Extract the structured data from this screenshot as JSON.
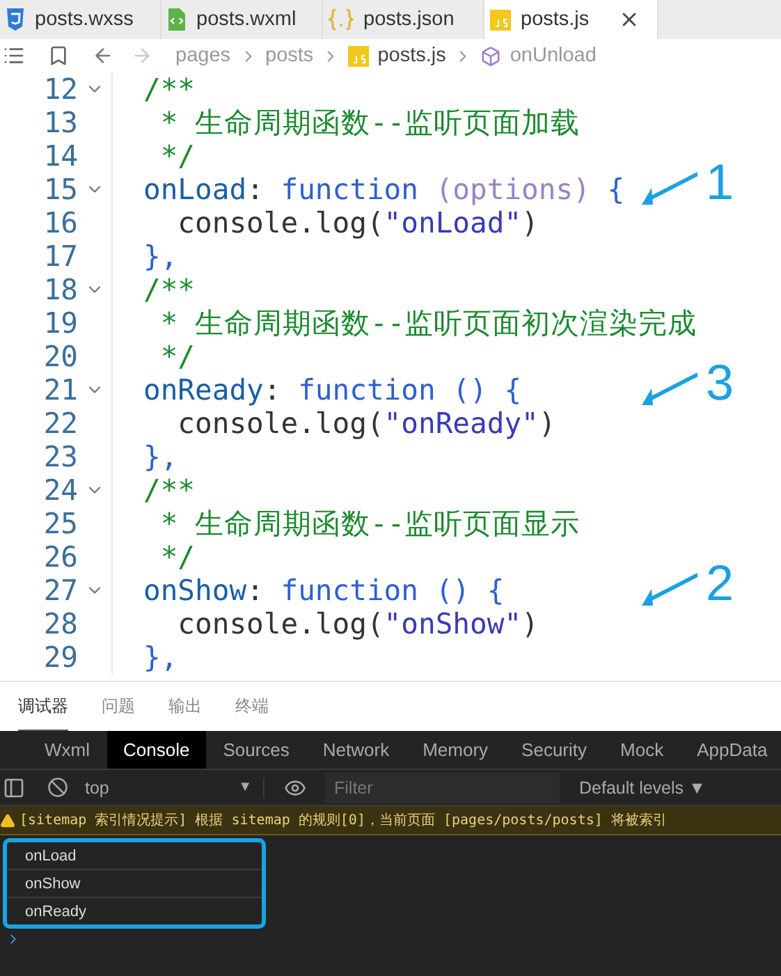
{
  "editor_tabs": [
    {
      "label": "posts.wxss",
      "kind": "css",
      "selected": false
    },
    {
      "label": "posts.wxml",
      "kind": "xml",
      "selected": false
    },
    {
      "label": "posts.json",
      "kind": "json",
      "selected": false
    },
    {
      "label": "posts.js",
      "kind": "js",
      "selected": true
    }
  ],
  "breadcrumb": [
    {
      "label": "pages",
      "kind": "folder",
      "current": false
    },
    {
      "label": "posts",
      "kind": "folder",
      "current": false
    },
    {
      "label": "posts.js",
      "kind": "js",
      "current": true
    },
    {
      "label": "onUnload",
      "kind": "symbol",
      "current": false
    }
  ],
  "code_lines": [
    {
      "number": "12",
      "fold": true,
      "segments": [
        {
          "text": "/**",
          "kind": "comment"
        }
      ]
    },
    {
      "number": "13",
      "fold": false,
      "segments": [
        {
          "text": " * 生命周期函数--监听页面加载",
          "kind": "comment"
        }
      ]
    },
    {
      "number": "14",
      "fold": false,
      "segments": [
        {
          "text": " */",
          "kind": "comment"
        }
      ]
    },
    {
      "number": "15",
      "fold": true,
      "annotation": "1",
      "segments": [
        {
          "text": "onLoad",
          "kind": "property"
        },
        {
          "text": ": ",
          "kind": "plain"
        },
        {
          "text": "function ",
          "kind": "keyword"
        },
        {
          "text": "(options)",
          "kind": "param"
        },
        {
          "text": " {",
          "kind": "keyword"
        }
      ]
    },
    {
      "number": "16",
      "fold": false,
      "segments": [
        {
          "text": "  console.log(",
          "kind": "plain"
        },
        {
          "text": "\"onLoad\"",
          "kind": "string"
        },
        {
          "text": ")",
          "kind": "plain"
        }
      ]
    },
    {
      "number": "17",
      "fold": false,
      "segments": [
        {
          "text": "},",
          "kind": "keyword"
        }
      ]
    },
    {
      "number": "18",
      "fold": true,
      "segments": [
        {
          "text": "/**",
          "kind": "comment"
        }
      ]
    },
    {
      "number": "19",
      "fold": false,
      "segments": [
        {
          "text": " * 生命周期函数--监听页面初次渲染完成",
          "kind": "comment"
        }
      ]
    },
    {
      "number": "20",
      "fold": false,
      "segments": [
        {
          "text": " */",
          "kind": "comment"
        }
      ]
    },
    {
      "number": "21",
      "fold": true,
      "annotation": "3",
      "segments": [
        {
          "text": "onReady",
          "kind": "property"
        },
        {
          "text": ": ",
          "kind": "plain"
        },
        {
          "text": "function",
          "kind": "keyword"
        },
        {
          "text": " () {",
          "kind": "keyword"
        }
      ]
    },
    {
      "number": "22",
      "fold": false,
      "segments": [
        {
          "text": "  console.log(",
          "kind": "plain"
        },
        {
          "text": "\"onReady\"",
          "kind": "string"
        },
        {
          "text": ")",
          "kind": "plain"
        }
      ]
    },
    {
      "number": "23",
      "fold": false,
      "segments": [
        {
          "text": "},",
          "kind": "keyword"
        }
      ]
    },
    {
      "number": "24",
      "fold": true,
      "segments": [
        {
          "text": "/**",
          "kind": "comment"
        }
      ]
    },
    {
      "number": "25",
      "fold": false,
      "segments": [
        {
          "text": " * 生命周期函数--监听页面显示",
          "kind": "comment"
        }
      ]
    },
    {
      "number": "26",
      "fold": false,
      "segments": [
        {
          "text": " */",
          "kind": "comment"
        }
      ]
    },
    {
      "number": "27",
      "fold": true,
      "annotation": "2",
      "segments": [
        {
          "text": "onShow",
          "kind": "property"
        },
        {
          "text": ": ",
          "kind": "plain"
        },
        {
          "text": "function",
          "kind": "keyword"
        },
        {
          "text": " () {",
          "kind": "keyword"
        }
      ]
    },
    {
      "number": "28",
      "fold": false,
      "segments": [
        {
          "text": "  console.log(",
          "kind": "plain"
        },
        {
          "text": "\"onShow\"",
          "kind": "string"
        },
        {
          "text": ")",
          "kind": "plain"
        }
      ]
    },
    {
      "number": "29",
      "fold": false,
      "segments": [
        {
          "text": "},",
          "kind": "keyword"
        }
      ]
    }
  ],
  "panel_tabs": [
    {
      "label": "调试器",
      "selected": true
    },
    {
      "label": "问题",
      "selected": false
    },
    {
      "label": "输出",
      "selected": false
    },
    {
      "label": "终端",
      "selected": false
    }
  ],
  "devtools_tabs": [
    {
      "label": "Wxml",
      "selected": false
    },
    {
      "label": "Console",
      "selected": true
    },
    {
      "label": "Sources",
      "selected": false
    },
    {
      "label": "Network",
      "selected": false
    },
    {
      "label": "Memory",
      "selected": false
    },
    {
      "label": "Security",
      "selected": false
    },
    {
      "label": "Mock",
      "selected": false
    },
    {
      "label": "AppData",
      "selected": false
    }
  ],
  "toolbar": {
    "context": "top",
    "filter_placeholder": "Filter",
    "levels": "Default levels ▼",
    "caret": "▼"
  },
  "console": {
    "warning": "[sitemap 索引情况提示] 根据 sitemap 的规则[0]，当前页面 [pages/posts/posts] 将被索引",
    "logs": [
      "onLoad",
      "onShow",
      "onReady"
    ]
  }
}
